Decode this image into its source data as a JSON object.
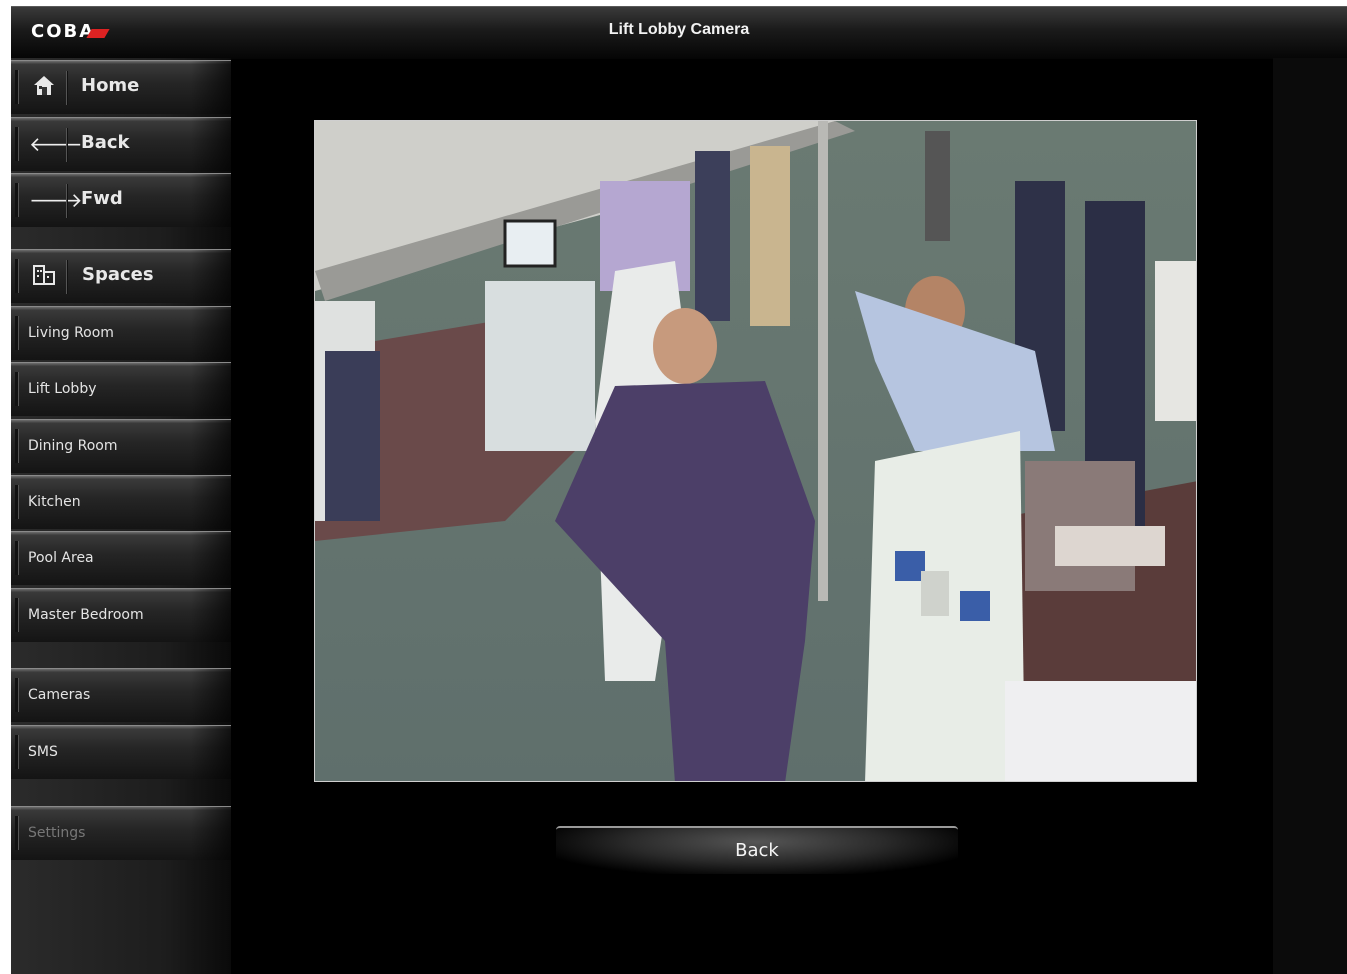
{
  "header": {
    "logo": "COBA",
    "title": "Lift Lobby Camera"
  },
  "nav": {
    "home": "Home",
    "back": "Back",
    "fwd": "Fwd",
    "spaces": "Spaces",
    "rooms": [
      "Living Room",
      "Lift Lobby",
      "Dining Room",
      "Kitchen",
      "Pool Area",
      "Master Bedroom"
    ],
    "cameras": "Cameras",
    "sms": "SMS",
    "settings": "Settings"
  },
  "camera_feed": {
    "name": "lift-lobby-camera-feed"
  },
  "footer": {
    "back_label": "Back"
  },
  "icons": {
    "home": "home-icon",
    "back": "arrow-left-icon",
    "fwd": "arrow-right-icon",
    "spaces": "buildings-icon"
  }
}
